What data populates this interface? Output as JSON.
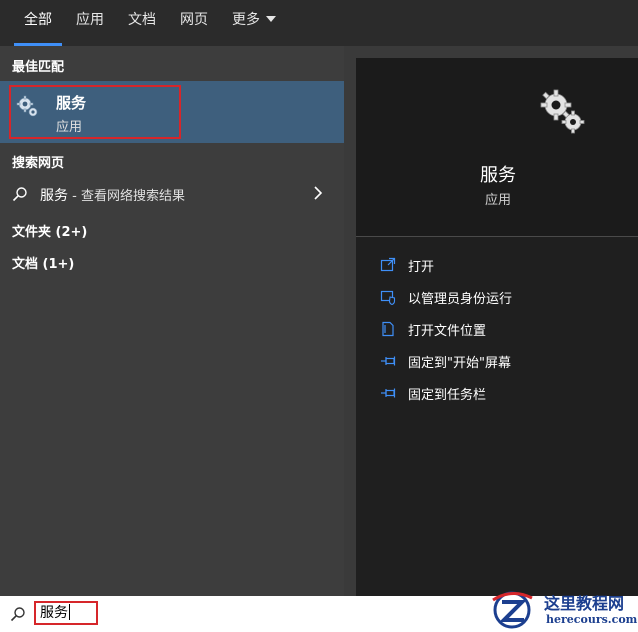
{
  "tabs": [
    {
      "label": "全部",
      "active": true
    },
    {
      "label": "应用"
    },
    {
      "label": "文档"
    },
    {
      "label": "网页"
    },
    {
      "label": "更多"
    }
  ],
  "left": {
    "best_match_title": "最佳匹配",
    "best_match": {
      "name": "服务",
      "type": "应用"
    },
    "web_title": "搜索网页",
    "web_result": {
      "query": "服务",
      "suffix": " - 查看网络搜索结果"
    },
    "folders": "文件夹 (2+)",
    "documents": "文档 (1+)"
  },
  "right": {
    "app_name": "服务",
    "app_type": "应用",
    "actions": [
      {
        "label": "打开",
        "icon": "open-icon"
      },
      {
        "label": "以管理员身份运行",
        "icon": "shield-icon"
      },
      {
        "label": "打开文件位置",
        "icon": "file-location-icon"
      },
      {
        "label": "固定到\"开始\"屏幕",
        "icon": "pin-icon"
      },
      {
        "label": "固定到任务栏",
        "icon": "pin-icon"
      }
    ]
  },
  "search": {
    "value": "服务"
  },
  "watermark": {
    "cn": "这里教程网",
    "en": "herecours.com"
  },
  "colors": {
    "accent": "#3f8ff7",
    "highlight": "#3e5f7d",
    "outline": "#d6262a"
  }
}
